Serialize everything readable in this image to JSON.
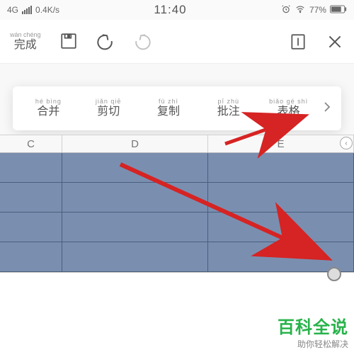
{
  "status": {
    "network": "4G",
    "speed": "0.4K/s",
    "time": "11:40",
    "battery": "77%"
  },
  "toolbar": {
    "finish_pinyin": "wán chéng",
    "finish_label": "完成"
  },
  "context_menu": {
    "items": [
      {
        "pinyin": "hé bìng",
        "label": "合并"
      },
      {
        "pinyin": "jiǎn qiē",
        "label": "剪切"
      },
      {
        "pinyin": "fù zhì",
        "label": "复制"
      },
      {
        "pinyin": "pī zhù",
        "label": "批注"
      },
      {
        "pinyin": "biǎo gé shì",
        "label": "表格"
      }
    ]
  },
  "columns": {
    "c1": "C",
    "c2": "D",
    "c3": "E"
  },
  "watermark": {
    "title": "百科全说",
    "subtitle": "助你轻松解决"
  },
  "colors": {
    "selection": "#7a8fb0",
    "arrow": "#d62323",
    "brand": "#27b34a"
  }
}
